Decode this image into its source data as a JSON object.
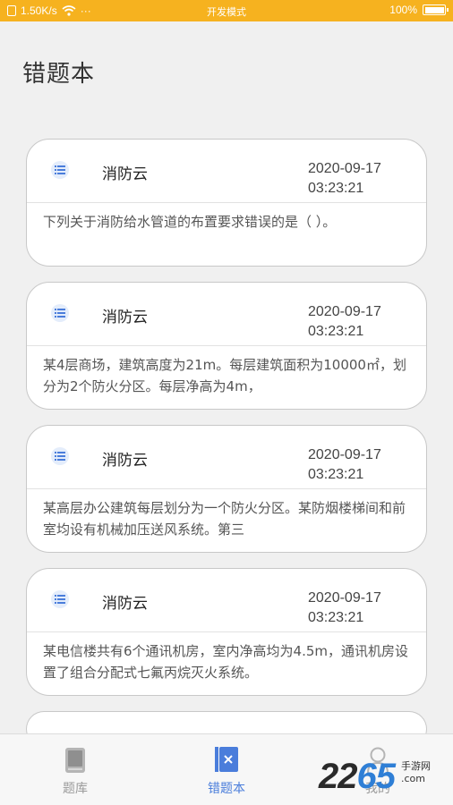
{
  "status_bar": {
    "speed": "1.50K/s",
    "dots": "···",
    "mode": "开发模式",
    "battery": "100%"
  },
  "page": {
    "title": "错题本"
  },
  "cards": [
    {
      "source": "消防云",
      "date": "2020-09-17",
      "time": "03:23:21",
      "text": "下列关于消防给水管道的布置要求错误的是（ ）。"
    },
    {
      "source": "消防云",
      "date": "2020-09-17",
      "time": "03:23:21",
      "text": "某4层商场，建筑高度为21m。每层建筑面积为10000㎡，划分为2个防火分区。每层净高为4m，"
    },
    {
      "source": "消防云",
      "date": "2020-09-17",
      "time": "03:23:21",
      "text": "某高层办公建筑每层划分为一个防火分区。某防烟楼梯间和前室均设有机械加压送风系统。第三"
    },
    {
      "source": "消防云",
      "date": "2020-09-17",
      "time": "03:23:21",
      "text": "某电信楼共有6个通讯机房，室内净高均为4.5m，通讯机房设置了组合分配式七氟丙烷灭火系统。"
    }
  ],
  "nav": {
    "items": [
      {
        "label": "题库",
        "icon": "book-icon"
      },
      {
        "label": "错题本",
        "icon": "wrong-book-icon"
      },
      {
        "label": "我的",
        "icon": "user-icon"
      }
    ],
    "active_color": "#4a7ddb",
    "inactive_color": "#9a9a9a"
  },
  "watermark": {
    "number_a": "22",
    "number_b": "65",
    "cn": "手游网",
    "domain": ".com"
  },
  "colors": {
    "status_bar": "#f6b21f",
    "background": "#f0f0f0",
    "card": "#ffffff"
  }
}
